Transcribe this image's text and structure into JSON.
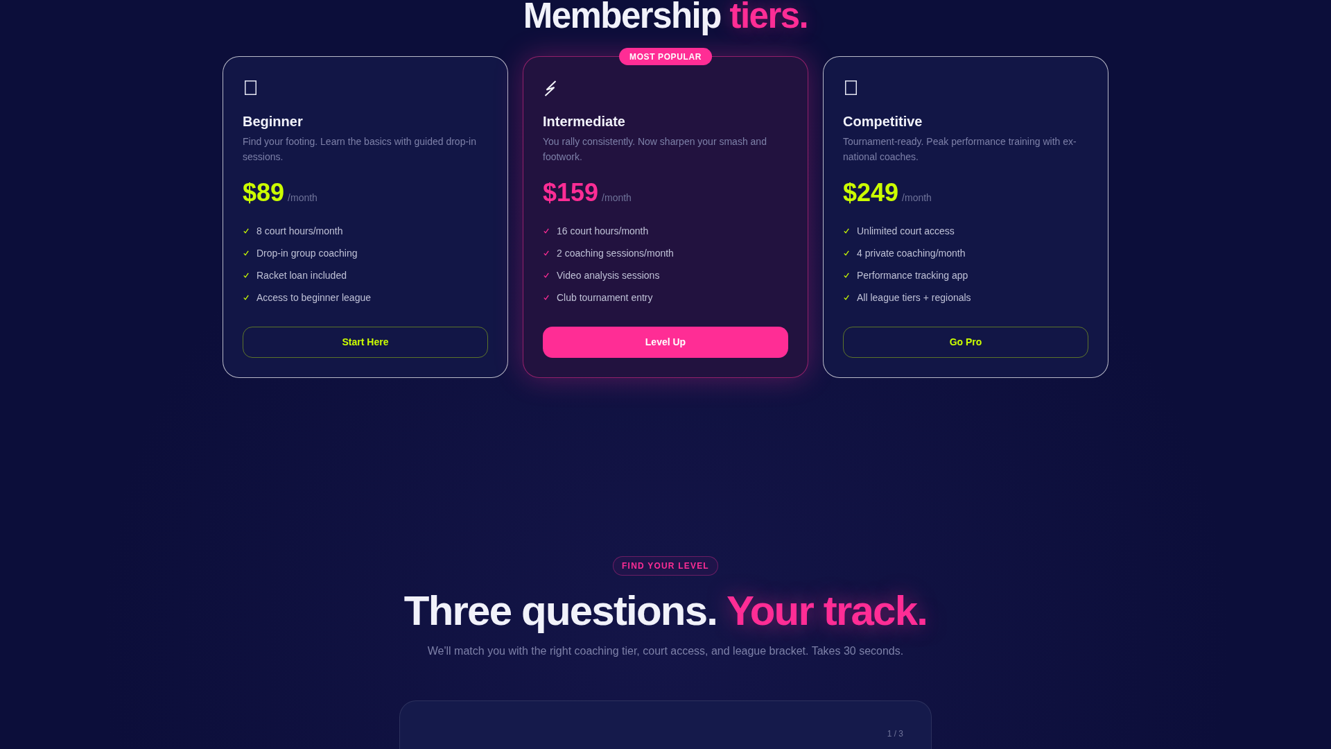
{
  "pricing": {
    "title": "Membership",
    "title_accent": "tiers.",
    "tiers": [
      {
        "kind": "standard",
        "name": "Beginner",
        "description": "Find your footing. Learn the basics with guided drop-in sessions.",
        "price": "$89",
        "period": "/month",
        "features": [
          "8 court hours/month",
          "Drop-in group coaching",
          "Racket loan included",
          "Access to beginner league"
        ],
        "button": "Start Here"
      },
      {
        "kind": "featured",
        "badge": "MOST POPULAR",
        "name": "Intermediate",
        "description": "You rally consistently. Now sharpen your smash and footwork.",
        "price": "$159",
        "period": "/month",
        "features": [
          "16 court hours/month",
          "2 coaching sessions/month",
          "Video analysis sessions",
          "Club tournament entry"
        ],
        "button": "Level Up"
      },
      {
        "kind": "standard",
        "name": "Competitive",
        "description": "Tournament-ready. Peak performance training with ex-national coaches.",
        "price": "$249",
        "period": "/month",
        "features": [
          "Unlimited court access",
          "4 private coaching/month",
          "Performance tracking app",
          "All league tiers + regionals"
        ],
        "button": "Go Pro"
      }
    ]
  },
  "quiz": {
    "eyebrow": "FIND YOUR LEVEL",
    "title": "Three questions.",
    "title_accent": "Your track.",
    "subtitle": "We'll match you with the right coaching tier, court access, and league bracket. Takes 30 seconds.",
    "progress": "1 / 3"
  }
}
